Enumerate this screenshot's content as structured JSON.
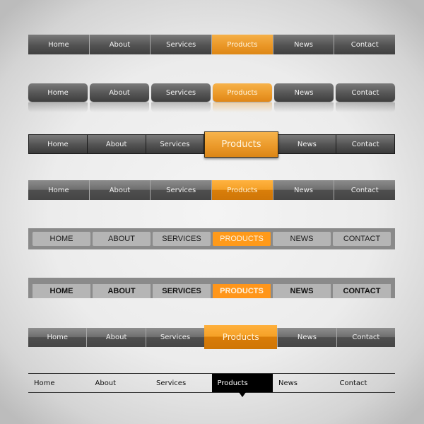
{
  "colors": {
    "accent": "#ea9727",
    "dark_item": "#525252",
    "light_item": "#b5b5b5",
    "frame": "#8a8a8a",
    "minimal_active": "#000000"
  },
  "navbars": [
    {
      "style": "flat-gradient",
      "active": "Products",
      "items": [
        {
          "label": "Home"
        },
        {
          "label": "About"
        },
        {
          "label": "Services"
        },
        {
          "label": "Products"
        },
        {
          "label": "News"
        },
        {
          "label": "Contact"
        }
      ]
    },
    {
      "style": "rounded-reflection",
      "active": "Products",
      "items": [
        {
          "label": "Home"
        },
        {
          "label": "About"
        },
        {
          "label": "Services"
        },
        {
          "label": "Products"
        },
        {
          "label": "News"
        },
        {
          "label": "Contact"
        }
      ]
    },
    {
      "style": "raised-active",
      "active": "Products",
      "items": [
        {
          "label": "Home"
        },
        {
          "label": "About"
        },
        {
          "label": "Services"
        },
        {
          "label": "Products"
        },
        {
          "label": "News"
        },
        {
          "label": "Contact"
        }
      ]
    },
    {
      "style": "split-tone",
      "active": "Products",
      "items": [
        {
          "label": "Home"
        },
        {
          "label": "About"
        },
        {
          "label": "Services"
        },
        {
          "label": "Products"
        },
        {
          "label": "News"
        },
        {
          "label": "Contact"
        }
      ]
    },
    {
      "style": "framed-buttons",
      "active": "PRODUCTS",
      "items": [
        {
          "label": "HOME"
        },
        {
          "label": "ABOUT"
        },
        {
          "label": "SERVICES"
        },
        {
          "label": "PRODUCTS"
        },
        {
          "label": "NEWS"
        },
        {
          "label": "CONTACT"
        }
      ]
    },
    {
      "style": "framed-tabs-bold",
      "active": "PRODUCTS",
      "items": [
        {
          "label": "HOME"
        },
        {
          "label": "ABOUT"
        },
        {
          "label": "SERVICES"
        },
        {
          "label": "PRODUCTS"
        },
        {
          "label": "NEWS"
        },
        {
          "label": "CONTACT"
        }
      ]
    },
    {
      "style": "split-tone-large-active",
      "active": "Products",
      "items": [
        {
          "label": "Home"
        },
        {
          "label": "About"
        },
        {
          "label": "Services"
        },
        {
          "label": "Products"
        },
        {
          "label": "News"
        },
        {
          "label": "Contact"
        }
      ]
    },
    {
      "style": "minimal-lines-pointer",
      "active": "Products",
      "items": [
        {
          "label": "Home"
        },
        {
          "label": "About"
        },
        {
          "label": "Services"
        },
        {
          "label": "Products"
        },
        {
          "label": "News"
        },
        {
          "label": "Contact"
        }
      ]
    }
  ]
}
